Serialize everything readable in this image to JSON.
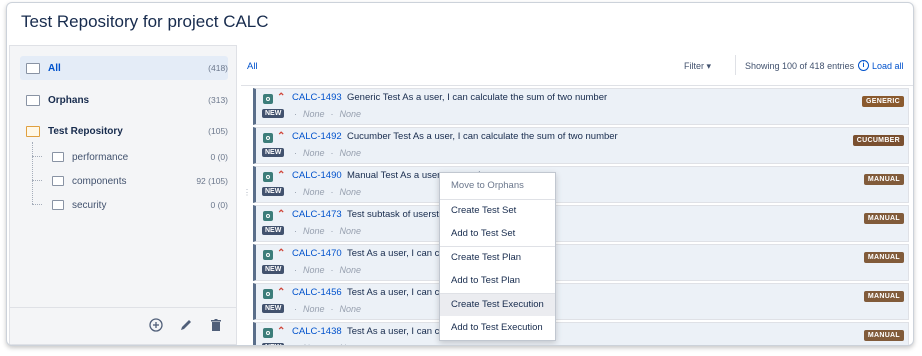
{
  "title": "Test Repository for project CALC",
  "tree": {
    "items": [
      {
        "label": "All",
        "count": "(418)"
      },
      {
        "label": "Orphans",
        "count": "(313)"
      },
      {
        "label": "Test Repository",
        "count": "(105)"
      }
    ],
    "children": [
      {
        "label": "performance",
        "count": "0 (0)"
      },
      {
        "label": "components",
        "count": "92 (105)"
      },
      {
        "label": "security",
        "count": "0 (0)"
      }
    ]
  },
  "toolbar": {
    "all": "All",
    "filter": "Filter ▾",
    "showing": "Showing 100 of 418 entries",
    "load_all": "Load all",
    "info_glyph": "i"
  },
  "footer_icons": [
    "add-circle-icon",
    "pencil-icon",
    "trash-icon"
  ],
  "rows": [
    {
      "key": "CALC-1493",
      "summary": "Generic Test As a user, I can calculate the sum of two number",
      "status": "NEW",
      "meta1": "None",
      "meta2": "None",
      "type": "GENERIC",
      "priority_glyph": "⌃",
      "sep": "·"
    },
    {
      "key": "CALC-1492",
      "summary": "Cucumber Test As a user, I can calculate the sum of two number",
      "status": "NEW",
      "meta1": "None",
      "meta2": "None",
      "type": "CUCUMBER",
      "priority_glyph": "⌃",
      "sep": "·"
    },
    {
      "key": "CALC-1490",
      "summary": "Manual Test As a user,                                            wo number",
      "status": "NEW",
      "meta1": "None",
      "meta2": "None",
      "type": "MANUAL",
      "priority_glyph": "⌃",
      "sep": "·"
    },
    {
      "key": "CALC-1473",
      "summary": "Test subtask of userst",
      "status": "NEW",
      "meta1": "None",
      "meta2": "None",
      "type": "MANUAL",
      "priority_glyph": "⌃",
      "sep": "·"
    },
    {
      "key": "CALC-1470",
      "summary": "Test As a user, I can c                                          rs",
      "status": "NEW",
      "meta1": "None",
      "meta2": "None",
      "type": "MANUAL",
      "priority_glyph": "⌃",
      "sep": "·"
    },
    {
      "key": "CALC-1456",
      "summary": "Test As a user, I can c                                          rs",
      "status": "NEW",
      "meta1": "None",
      "meta2": "None",
      "type": "MANUAL",
      "priority_glyph": "⌃",
      "sep": "·"
    },
    {
      "key": "CALC-1438",
      "summary": "Test As a user, I can c                                          bers",
      "status": "NEW",
      "meta1": "None",
      "meta2": "None",
      "type": "MANUAL",
      "priority_glyph": "⌃",
      "sep": "·"
    }
  ],
  "context_menu": {
    "items": [
      "Move to Orphans",
      "Create Test Set",
      "Add to Test Set",
      "Create Test Plan",
      "Add to Test Plan",
      "Create Test Execution",
      "Add to Test Execution"
    ]
  }
}
